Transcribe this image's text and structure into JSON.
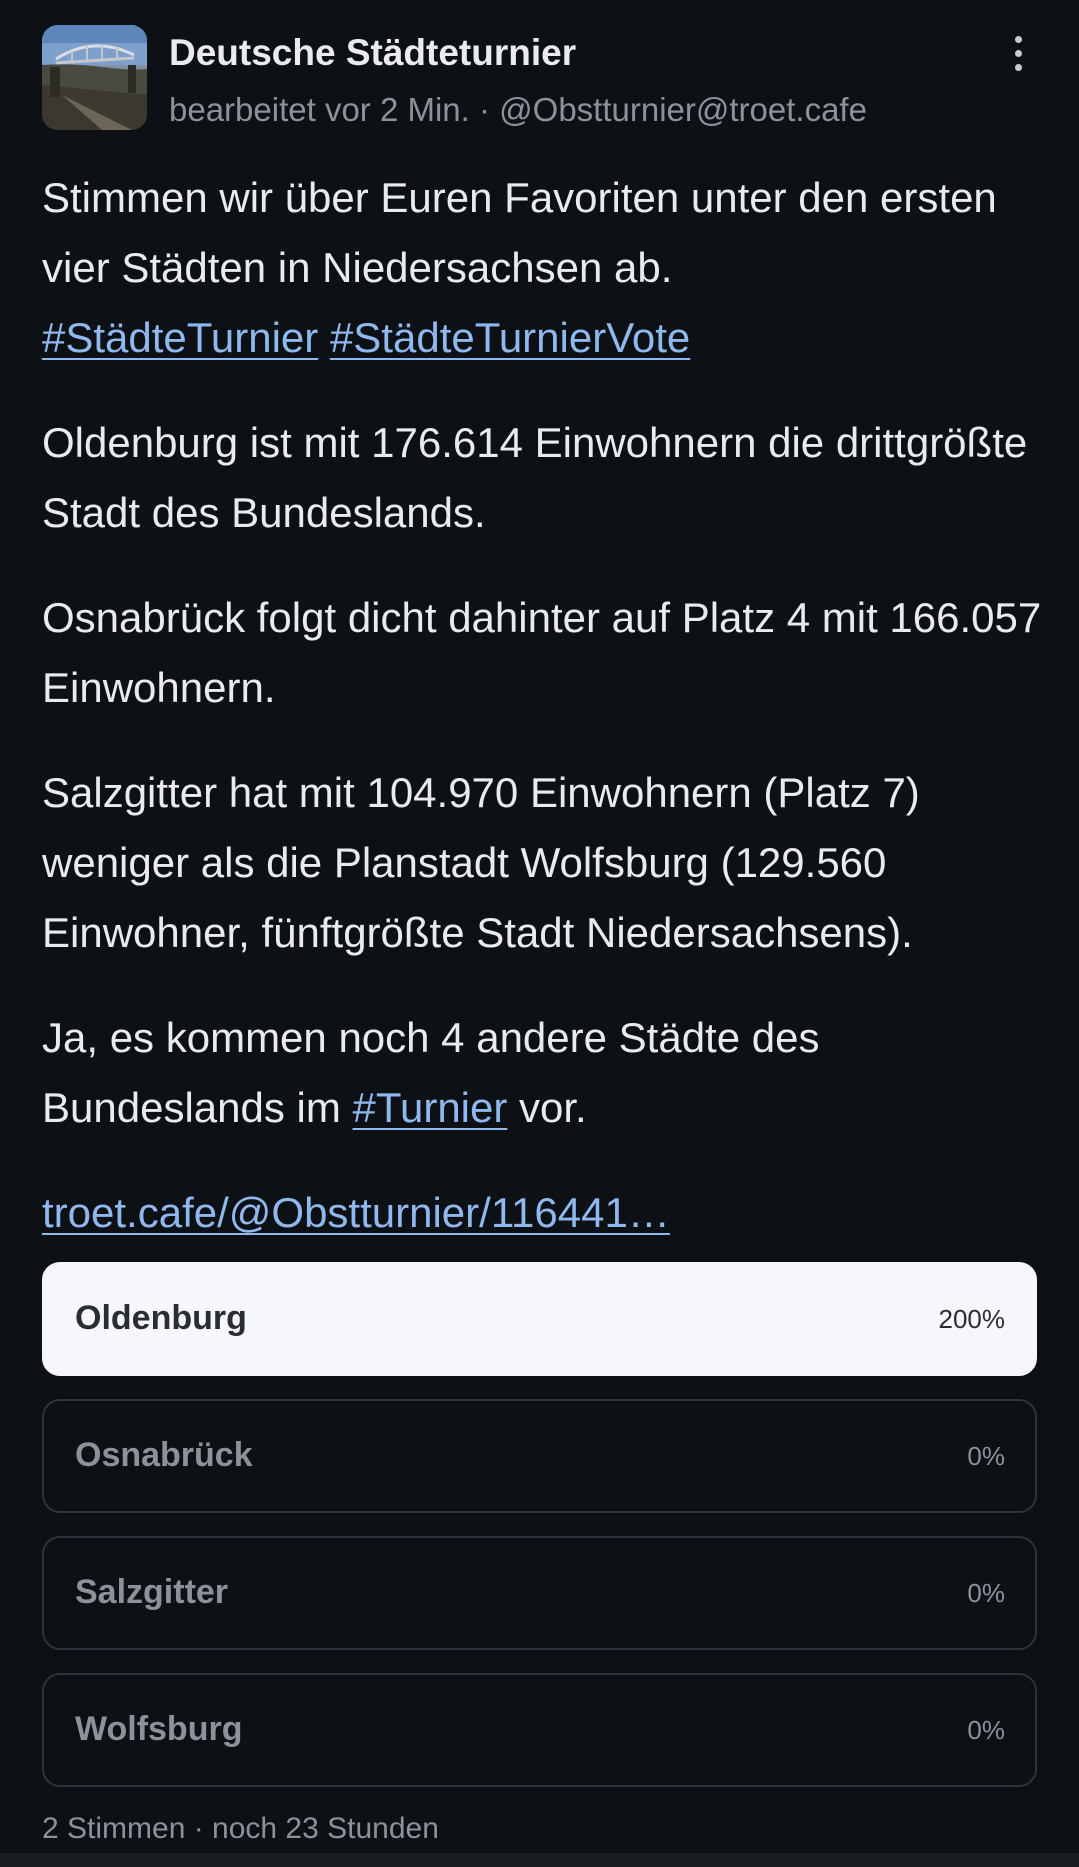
{
  "author": {
    "name": "Deutsche Städteturnier",
    "meta": "bearbeitet vor 2 Min. · @Obstturnier@troet.cafe",
    "avatar_icon": "bridge-photo-avatar"
  },
  "menu_icon": "more-vertical-icon",
  "paragraphs": {
    "p1_text": "Stimmen wir über Euren Favoriten unter den ersten vier Städten in Niedersachsen ab.",
    "p1_tag1": "#StädteTurnier",
    "p1_tag2": "#StädteTurnierVote",
    "p2": "Oldenburg ist mit 176.614 Einwohnern die drittgrößte Stadt des Bundeslands.",
    "p3": "Osnabrück folgt dicht dahinter auf Platz 4 mit 166.057 Einwohnern.",
    "p4": "Salzgitter hat mit 104.970 Einwohnern (Platz 7) weniger als die Planstadt Wolfsburg (129.560 Einwohner, fünftgrößte Stadt Niedersachsens).",
    "p5_before": "Ja, es kommen noch 4 andere Städte des Bundeslands im",
    "p5_tag": "#Turnier",
    "p5_after": "vor.",
    "link": "troet.cafe/@Obstturnier/116441…"
  },
  "poll": {
    "options": [
      {
        "label": "Oldenburg",
        "percent": "200%"
      },
      {
        "label": "Osnabrück",
        "percent": "0%"
      },
      {
        "label": "Salzgitter",
        "percent": "0%"
      },
      {
        "label": "Wolfsburg",
        "percent": "0%"
      }
    ],
    "footer": "2 Stimmen · noch 23 Stunden"
  },
  "colors": {
    "background": "#0d1014",
    "text": "#e9ebef",
    "muted": "#8d919a",
    "link": "#8fb8ee",
    "winner_bg": "#f6f7fb"
  }
}
